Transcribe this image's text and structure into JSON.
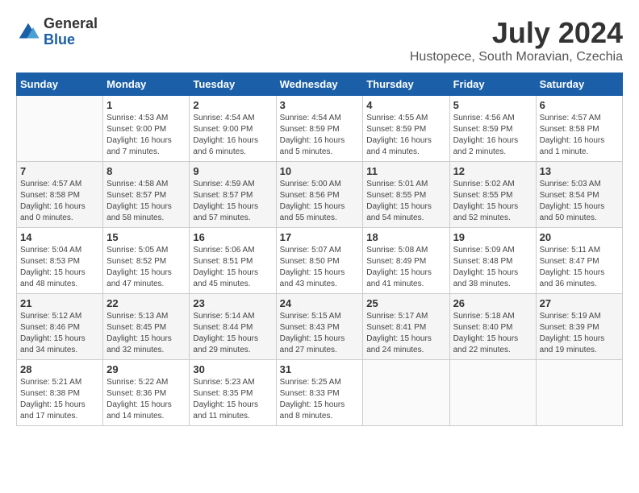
{
  "logo": {
    "general": "General",
    "blue": "Blue"
  },
  "title": "July 2024",
  "subtitle": "Hustopece, South Moravian, Czechia",
  "days_of_week": [
    "Sunday",
    "Monday",
    "Tuesday",
    "Wednesday",
    "Thursday",
    "Friday",
    "Saturday"
  ],
  "weeks": [
    [
      {
        "day": "",
        "info": ""
      },
      {
        "day": "1",
        "info": "Sunrise: 4:53 AM\nSunset: 9:00 PM\nDaylight: 16 hours\nand 7 minutes."
      },
      {
        "day": "2",
        "info": "Sunrise: 4:54 AM\nSunset: 9:00 PM\nDaylight: 16 hours\nand 6 minutes."
      },
      {
        "day": "3",
        "info": "Sunrise: 4:54 AM\nSunset: 8:59 PM\nDaylight: 16 hours\nand 5 minutes."
      },
      {
        "day": "4",
        "info": "Sunrise: 4:55 AM\nSunset: 8:59 PM\nDaylight: 16 hours\nand 4 minutes."
      },
      {
        "day": "5",
        "info": "Sunrise: 4:56 AM\nSunset: 8:59 PM\nDaylight: 16 hours\nand 2 minutes."
      },
      {
        "day": "6",
        "info": "Sunrise: 4:57 AM\nSunset: 8:58 PM\nDaylight: 16 hours\nand 1 minute."
      }
    ],
    [
      {
        "day": "7",
        "info": "Sunrise: 4:57 AM\nSunset: 8:58 PM\nDaylight: 16 hours\nand 0 minutes."
      },
      {
        "day": "8",
        "info": "Sunrise: 4:58 AM\nSunset: 8:57 PM\nDaylight: 15 hours\nand 58 minutes."
      },
      {
        "day": "9",
        "info": "Sunrise: 4:59 AM\nSunset: 8:57 PM\nDaylight: 15 hours\nand 57 minutes."
      },
      {
        "day": "10",
        "info": "Sunrise: 5:00 AM\nSunset: 8:56 PM\nDaylight: 15 hours\nand 55 minutes."
      },
      {
        "day": "11",
        "info": "Sunrise: 5:01 AM\nSunset: 8:55 PM\nDaylight: 15 hours\nand 54 minutes."
      },
      {
        "day": "12",
        "info": "Sunrise: 5:02 AM\nSunset: 8:55 PM\nDaylight: 15 hours\nand 52 minutes."
      },
      {
        "day": "13",
        "info": "Sunrise: 5:03 AM\nSunset: 8:54 PM\nDaylight: 15 hours\nand 50 minutes."
      }
    ],
    [
      {
        "day": "14",
        "info": "Sunrise: 5:04 AM\nSunset: 8:53 PM\nDaylight: 15 hours\nand 48 minutes."
      },
      {
        "day": "15",
        "info": "Sunrise: 5:05 AM\nSunset: 8:52 PM\nDaylight: 15 hours\nand 47 minutes."
      },
      {
        "day": "16",
        "info": "Sunrise: 5:06 AM\nSunset: 8:51 PM\nDaylight: 15 hours\nand 45 minutes."
      },
      {
        "day": "17",
        "info": "Sunrise: 5:07 AM\nSunset: 8:50 PM\nDaylight: 15 hours\nand 43 minutes."
      },
      {
        "day": "18",
        "info": "Sunrise: 5:08 AM\nSunset: 8:49 PM\nDaylight: 15 hours\nand 41 minutes."
      },
      {
        "day": "19",
        "info": "Sunrise: 5:09 AM\nSunset: 8:48 PM\nDaylight: 15 hours\nand 38 minutes."
      },
      {
        "day": "20",
        "info": "Sunrise: 5:11 AM\nSunset: 8:47 PM\nDaylight: 15 hours\nand 36 minutes."
      }
    ],
    [
      {
        "day": "21",
        "info": "Sunrise: 5:12 AM\nSunset: 8:46 PM\nDaylight: 15 hours\nand 34 minutes."
      },
      {
        "day": "22",
        "info": "Sunrise: 5:13 AM\nSunset: 8:45 PM\nDaylight: 15 hours\nand 32 minutes."
      },
      {
        "day": "23",
        "info": "Sunrise: 5:14 AM\nSunset: 8:44 PM\nDaylight: 15 hours\nand 29 minutes."
      },
      {
        "day": "24",
        "info": "Sunrise: 5:15 AM\nSunset: 8:43 PM\nDaylight: 15 hours\nand 27 minutes."
      },
      {
        "day": "25",
        "info": "Sunrise: 5:17 AM\nSunset: 8:41 PM\nDaylight: 15 hours\nand 24 minutes."
      },
      {
        "day": "26",
        "info": "Sunrise: 5:18 AM\nSunset: 8:40 PM\nDaylight: 15 hours\nand 22 minutes."
      },
      {
        "day": "27",
        "info": "Sunrise: 5:19 AM\nSunset: 8:39 PM\nDaylight: 15 hours\nand 19 minutes."
      }
    ],
    [
      {
        "day": "28",
        "info": "Sunrise: 5:21 AM\nSunset: 8:38 PM\nDaylight: 15 hours\nand 17 minutes."
      },
      {
        "day": "29",
        "info": "Sunrise: 5:22 AM\nSunset: 8:36 PM\nDaylight: 15 hours\nand 14 minutes."
      },
      {
        "day": "30",
        "info": "Sunrise: 5:23 AM\nSunset: 8:35 PM\nDaylight: 15 hours\nand 11 minutes."
      },
      {
        "day": "31",
        "info": "Sunrise: 5:25 AM\nSunset: 8:33 PM\nDaylight: 15 hours\nand 8 minutes."
      },
      {
        "day": "",
        "info": ""
      },
      {
        "day": "",
        "info": ""
      },
      {
        "day": "",
        "info": ""
      }
    ]
  ]
}
